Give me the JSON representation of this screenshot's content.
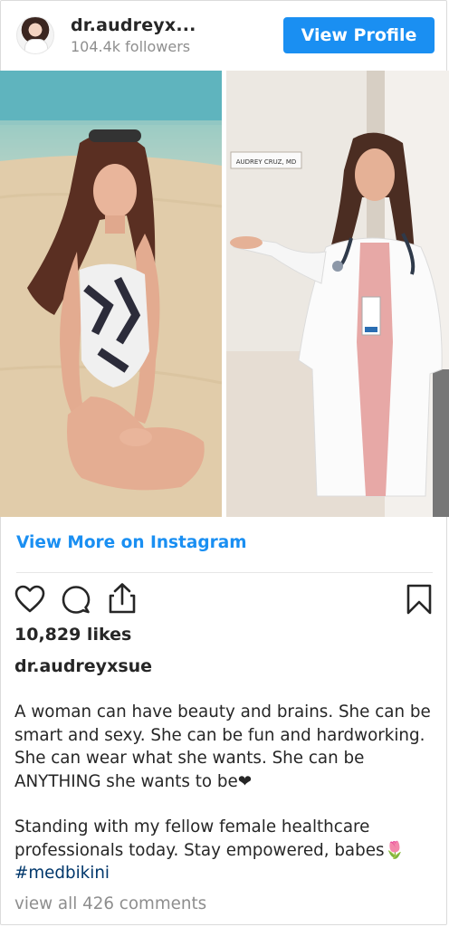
{
  "header": {
    "username": "dr.audreyx...",
    "followers": "104.4k followers",
    "view_profile_label": "View Profile"
  },
  "photos": {
    "nameplate": "AUDREY CRUZ, MD"
  },
  "view_more_label": "View More on Instagram",
  "likes": "10,829 likes",
  "caption": {
    "username": "dr.audreyxsue",
    "paragraph1": "A woman can have beauty and brains. She can be smart and sexy. She can be fun and hardworking. She can wear what she wants. She can be ANYTHING she wants to be❤",
    "paragraph2": "Standing with my fellow female healthcare professionals today. Stay empowered, babes🌷",
    "hashtag": "#medbikini"
  },
  "comments_link": "view all 426 comments",
  "colors": {
    "accent": "#1a8ff2",
    "hashtag": "#00376b",
    "muted": "#8e8e8e"
  },
  "icons": [
    "heart-icon",
    "comment-icon",
    "share-icon",
    "bookmark-icon"
  ]
}
